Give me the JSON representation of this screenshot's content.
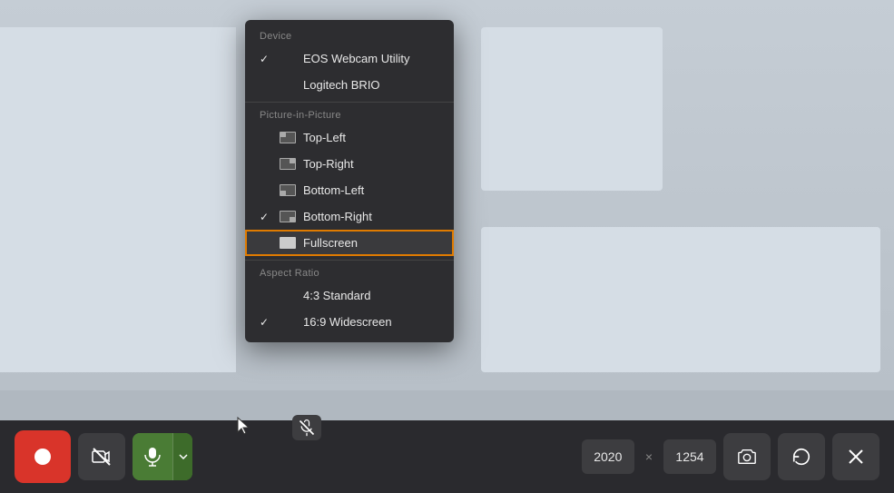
{
  "background": {
    "color": "#b8c0c8"
  },
  "dropdown": {
    "sections": {
      "device": {
        "label": "Device",
        "items": [
          {
            "id": "eos",
            "label": "EOS Webcam Utility",
            "checked": true,
            "icon": null
          },
          {
            "id": "logitech",
            "label": "Logitech BRIO",
            "checked": false,
            "icon": null
          }
        ]
      },
      "pip": {
        "label": "Picture-in-Picture",
        "items": [
          {
            "id": "top-left",
            "label": "Top-Left",
            "checked": false,
            "icon": "pip-top-left"
          },
          {
            "id": "top-right",
            "label": "Top-Right",
            "checked": false,
            "icon": "pip-top-right"
          },
          {
            "id": "bottom-left",
            "label": "Bottom-Left",
            "checked": false,
            "icon": "pip-bottom-left"
          },
          {
            "id": "bottom-right",
            "label": "Bottom-Right",
            "checked": true,
            "icon": "pip-bottom-right"
          },
          {
            "id": "fullscreen",
            "label": "Fullscreen",
            "checked": false,
            "icon": "fullscreen",
            "highlighted": true
          }
        ]
      },
      "aspect": {
        "label": "Aspect Ratio",
        "items": [
          {
            "id": "4-3",
            "label": "4:3 Standard",
            "checked": false
          },
          {
            "id": "16-9",
            "label": "16:9 Widescreen",
            "checked": true
          }
        ]
      }
    }
  },
  "toolbar": {
    "record_label": "Record",
    "dimension_w": "2020",
    "dimension_h": "1254",
    "dimension_separator": "×"
  }
}
